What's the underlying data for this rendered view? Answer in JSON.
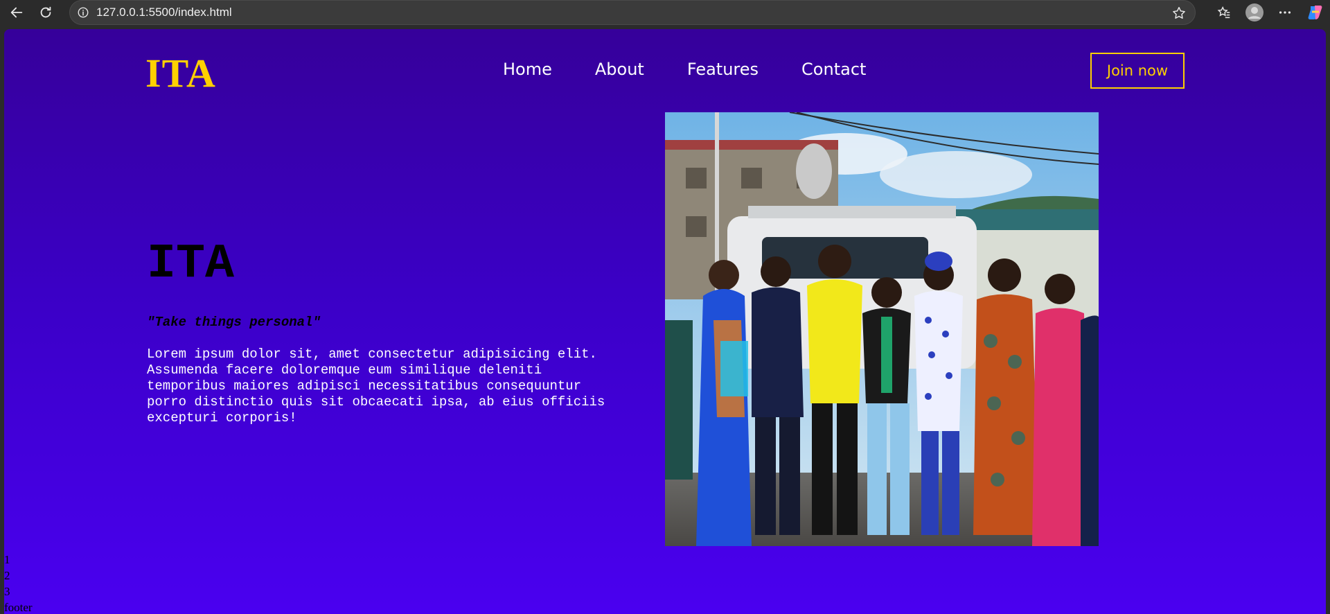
{
  "browser": {
    "url": "127.0.0.1:5500/index.html"
  },
  "header": {
    "logo": "ITA",
    "nav": [
      "Home",
      "About",
      "Features",
      "Contact"
    ],
    "join_label": "Join now"
  },
  "hero": {
    "title": "ITA",
    "quote": "\"Take things personal\"",
    "text": "Lorem ipsum dolor sit, amet consectetur adipisicing elit. Assumenda facere doloremque eum similique deleniti temporibus maiores adipisci necessitatibus consequuntur porro distinctio quis sit obcaecati ipsa, ab eius officiis excepturi corporis!"
  },
  "bottom_list": [
    "1",
    "2",
    "3",
    "footer"
  ],
  "colors": {
    "accent": "#ffd000",
    "bg_top": "#36009a",
    "bg_bottom": "#4a00f0"
  }
}
